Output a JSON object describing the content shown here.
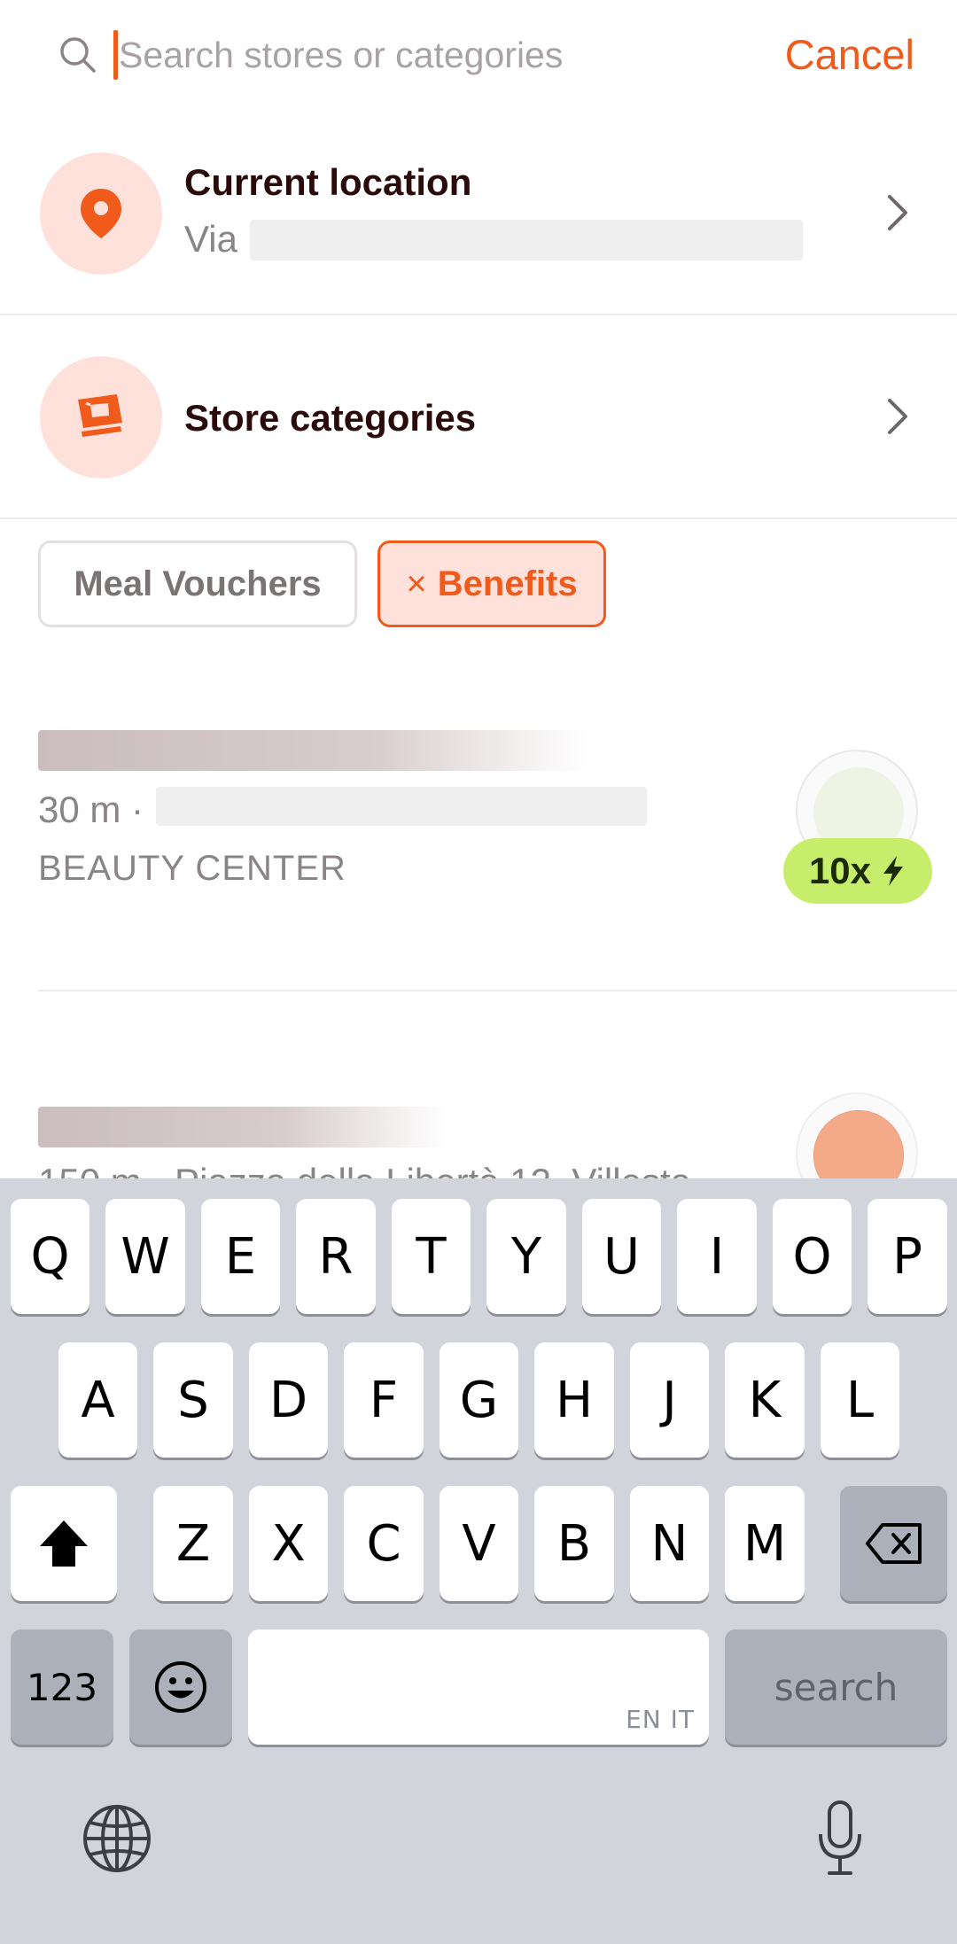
{
  "search": {
    "placeholder": "Search stores or categories",
    "value": "",
    "cancel_label": "Cancel"
  },
  "location": {
    "title": "Current location",
    "subtitle_prefix": "Via",
    "icon": "location-pin-icon"
  },
  "categories": {
    "title": "Store categories",
    "icon": "store-categories-icon"
  },
  "filters": {
    "meal_vouchers_label": "Meal Vouchers",
    "benefits_remove": "×",
    "benefits_label": "Benefits"
  },
  "stores": [
    {
      "distance": "30 m ·",
      "category": "BEAUTY CENTER",
      "multiplier": "10x"
    },
    {
      "meta_partial": "150 m · Piazza della Libertà 12, Villesta"
    }
  ],
  "keyboard": {
    "row1": [
      "Q",
      "W",
      "E",
      "R",
      "T",
      "Y",
      "U",
      "I",
      "O",
      "P"
    ],
    "row2": [
      "A",
      "S",
      "D",
      "F",
      "G",
      "H",
      "J",
      "K",
      "L"
    ],
    "row3": [
      "Z",
      "X",
      "C",
      "V",
      "B",
      "N",
      "M"
    ],
    "numbers_label": "123",
    "search_label": "search",
    "space_languages": "EN IT"
  },
  "colors": {
    "accent": "#f05a1a",
    "accent_light": "#ffe1dc",
    "badge_green": "#c6ee6a"
  }
}
